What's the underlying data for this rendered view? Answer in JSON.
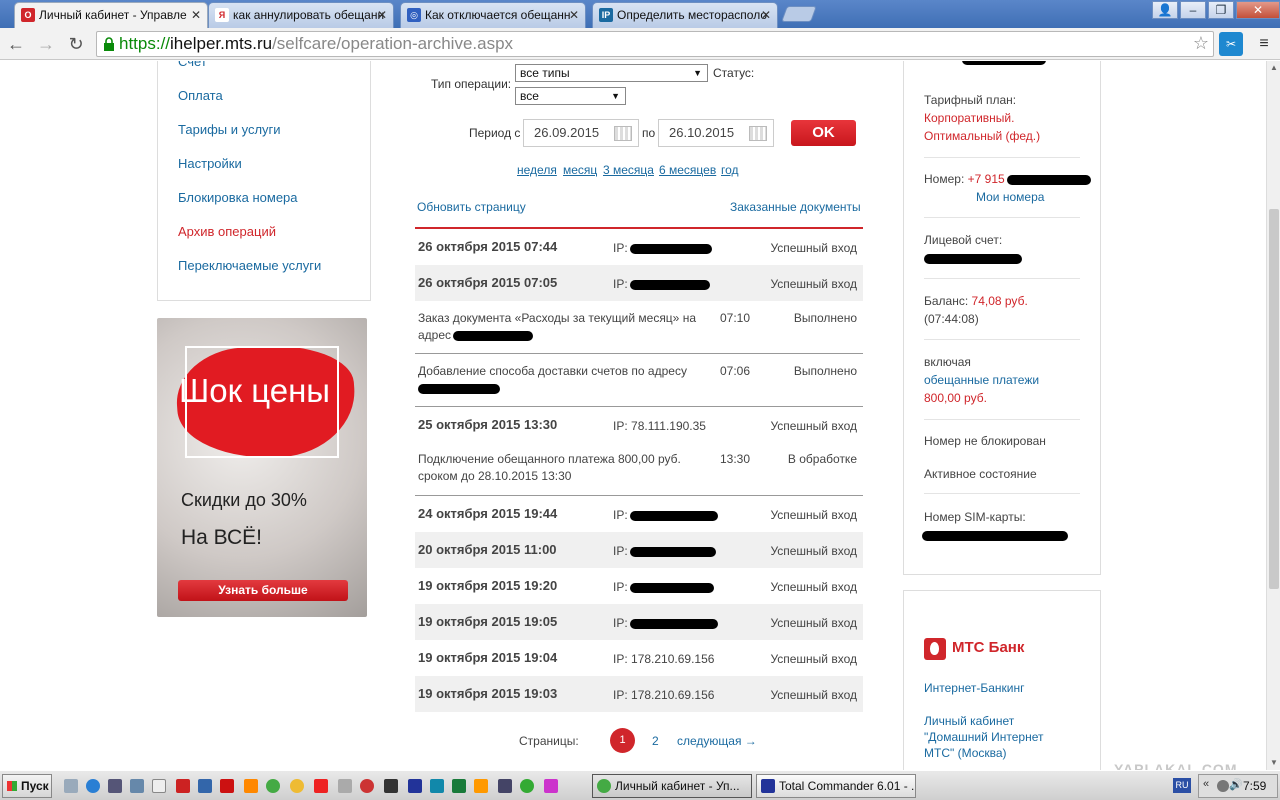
{
  "browser": {
    "tabs": [
      {
        "title": "Личный кабинет - Управле",
        "icon": "opera-icon",
        "color": "#d0262b"
      },
      {
        "title": "как аннулировать обещанн",
        "icon": "yandex-icon",
        "color": "#d0262b"
      },
      {
        "title": "Как отключается обещанн",
        "icon": "globe-icon",
        "color": "#3060c0"
      },
      {
        "title": "Определить месторасполо",
        "icon": "ip-icon",
        "color": "#1a6aa0"
      }
    ],
    "url_scheme": "https://",
    "url_host": "ihelper.mts.ru",
    "url_path": "/selfcare/operation-archive.aspx"
  },
  "left_menu": {
    "items": [
      {
        "label": "Счет"
      },
      {
        "label": "Оплата"
      },
      {
        "label": "Тарифы и услуги"
      },
      {
        "label": "Настройки"
      },
      {
        "label": "Блокировка номера"
      },
      {
        "label": "Архив операций",
        "active": true
      },
      {
        "label": "Переключаемые услуги"
      }
    ]
  },
  "promo": {
    "title": "Шок цены",
    "line1": "Скидки до 30%",
    "line2": "На ВСЁ!",
    "button": "Узнать больше"
  },
  "filters": {
    "op_type_label": "Тип операции:",
    "op_type_value": "все типы",
    "status_label": "Статус:",
    "status_value": "все",
    "period_label": "Период с",
    "period_to_label": "по",
    "date_from": "26.09.2015",
    "date_to": "26.10.2015",
    "ok_label": "OK",
    "periods": [
      "неделя",
      "месяц",
      "3 месяца",
      "6 месяцев",
      "год"
    ]
  },
  "links": {
    "refresh": "Обновить страницу",
    "ordered_docs": "Заказанные документы"
  },
  "operations": [
    {
      "date": "26 октября 2015 07:44",
      "ip_label": "IP:",
      "ip": "",
      "status": "Успешный вход"
    },
    {
      "date": "26 октября 2015 07:05",
      "ip_label": "IP:",
      "ip": "",
      "status": "Успешный вход"
    },
    {
      "text": "Заказ документа «Расходы за текущий месяц» на адрес",
      "time": "07:10",
      "status": "Выполнено"
    },
    {
      "text": "Добавление способа доставки счетов по адресу",
      "time": "07:06",
      "status": "Выполнено"
    },
    {
      "date": "25 октября 2015 13:30",
      "ip_label": "IP:",
      "ip": "78.111.190.35",
      "status": "Успешный вход"
    },
    {
      "text": "Подключение обещанного платежа 800,00 руб. сроком до 28.10.2015 13:30",
      "time": "13:30",
      "status": "В обработке"
    },
    {
      "date": "24 октября 2015 19:44",
      "ip_label": "IP:",
      "ip": "",
      "status": "Успешный вход"
    },
    {
      "date": "20 октября 2015 11:00",
      "ip_label": "IP:",
      "ip": "",
      "status": "Успешный вход"
    },
    {
      "date": "19 октября 2015 19:20",
      "ip_label": "IP:",
      "ip": "",
      "status": "Успешный вход"
    },
    {
      "date": "19 октября 2015 19:05",
      "ip_label": "IP:",
      "ip": "",
      "status": "Успешный вход"
    },
    {
      "date": "19 октября 2015 19:04",
      "ip_label": "IP:",
      "ip": "178.210.69.156",
      "status": "Успешный вход"
    },
    {
      "date": "19 октября 2015 19:03",
      "ip_label": "IP:",
      "ip": "178.210.69.156",
      "status": "Успешный вход"
    }
  ],
  "pagination": {
    "label": "Страницы:",
    "current": "1",
    "page2": "2",
    "next": "следующая →"
  },
  "account": {
    "tariff_label": "Тарифный план:",
    "tariff_line1": "Корпоративный.",
    "tariff_line2": "Оптимальный (фед.)",
    "number_label": "Номер:",
    "number_prefix": "+7 915",
    "my_numbers": "Мои номера",
    "account_label": "Лицевой счет:",
    "balance_label": "Баланс:",
    "balance_value": "74,08 руб.",
    "balance_time": "(07:44:08)",
    "including": "включая",
    "promised_line1": "обещанные платежи",
    "promised_value": "800,00 руб.",
    "not_blocked": "Номер не блокирован",
    "active_state": "Активное состояние",
    "sim_label": "Номер SIM-карты:"
  },
  "bank": {
    "name": "МТС Банк",
    "link1": "Интернет-Банкинг",
    "link2_l1": "Личный кабинет",
    "link2_l2": "\"Домашний Интернет",
    "link2_l3": "МТС\" (Москва)"
  },
  "watermark": "YAPLAKAL.COM",
  "taskbar": {
    "start": "Пуск",
    "tasks": [
      "Личный кабинет - Уп...",
      "Total Commander 6.01 - ..."
    ],
    "lang": "RU",
    "time": "7:59"
  }
}
